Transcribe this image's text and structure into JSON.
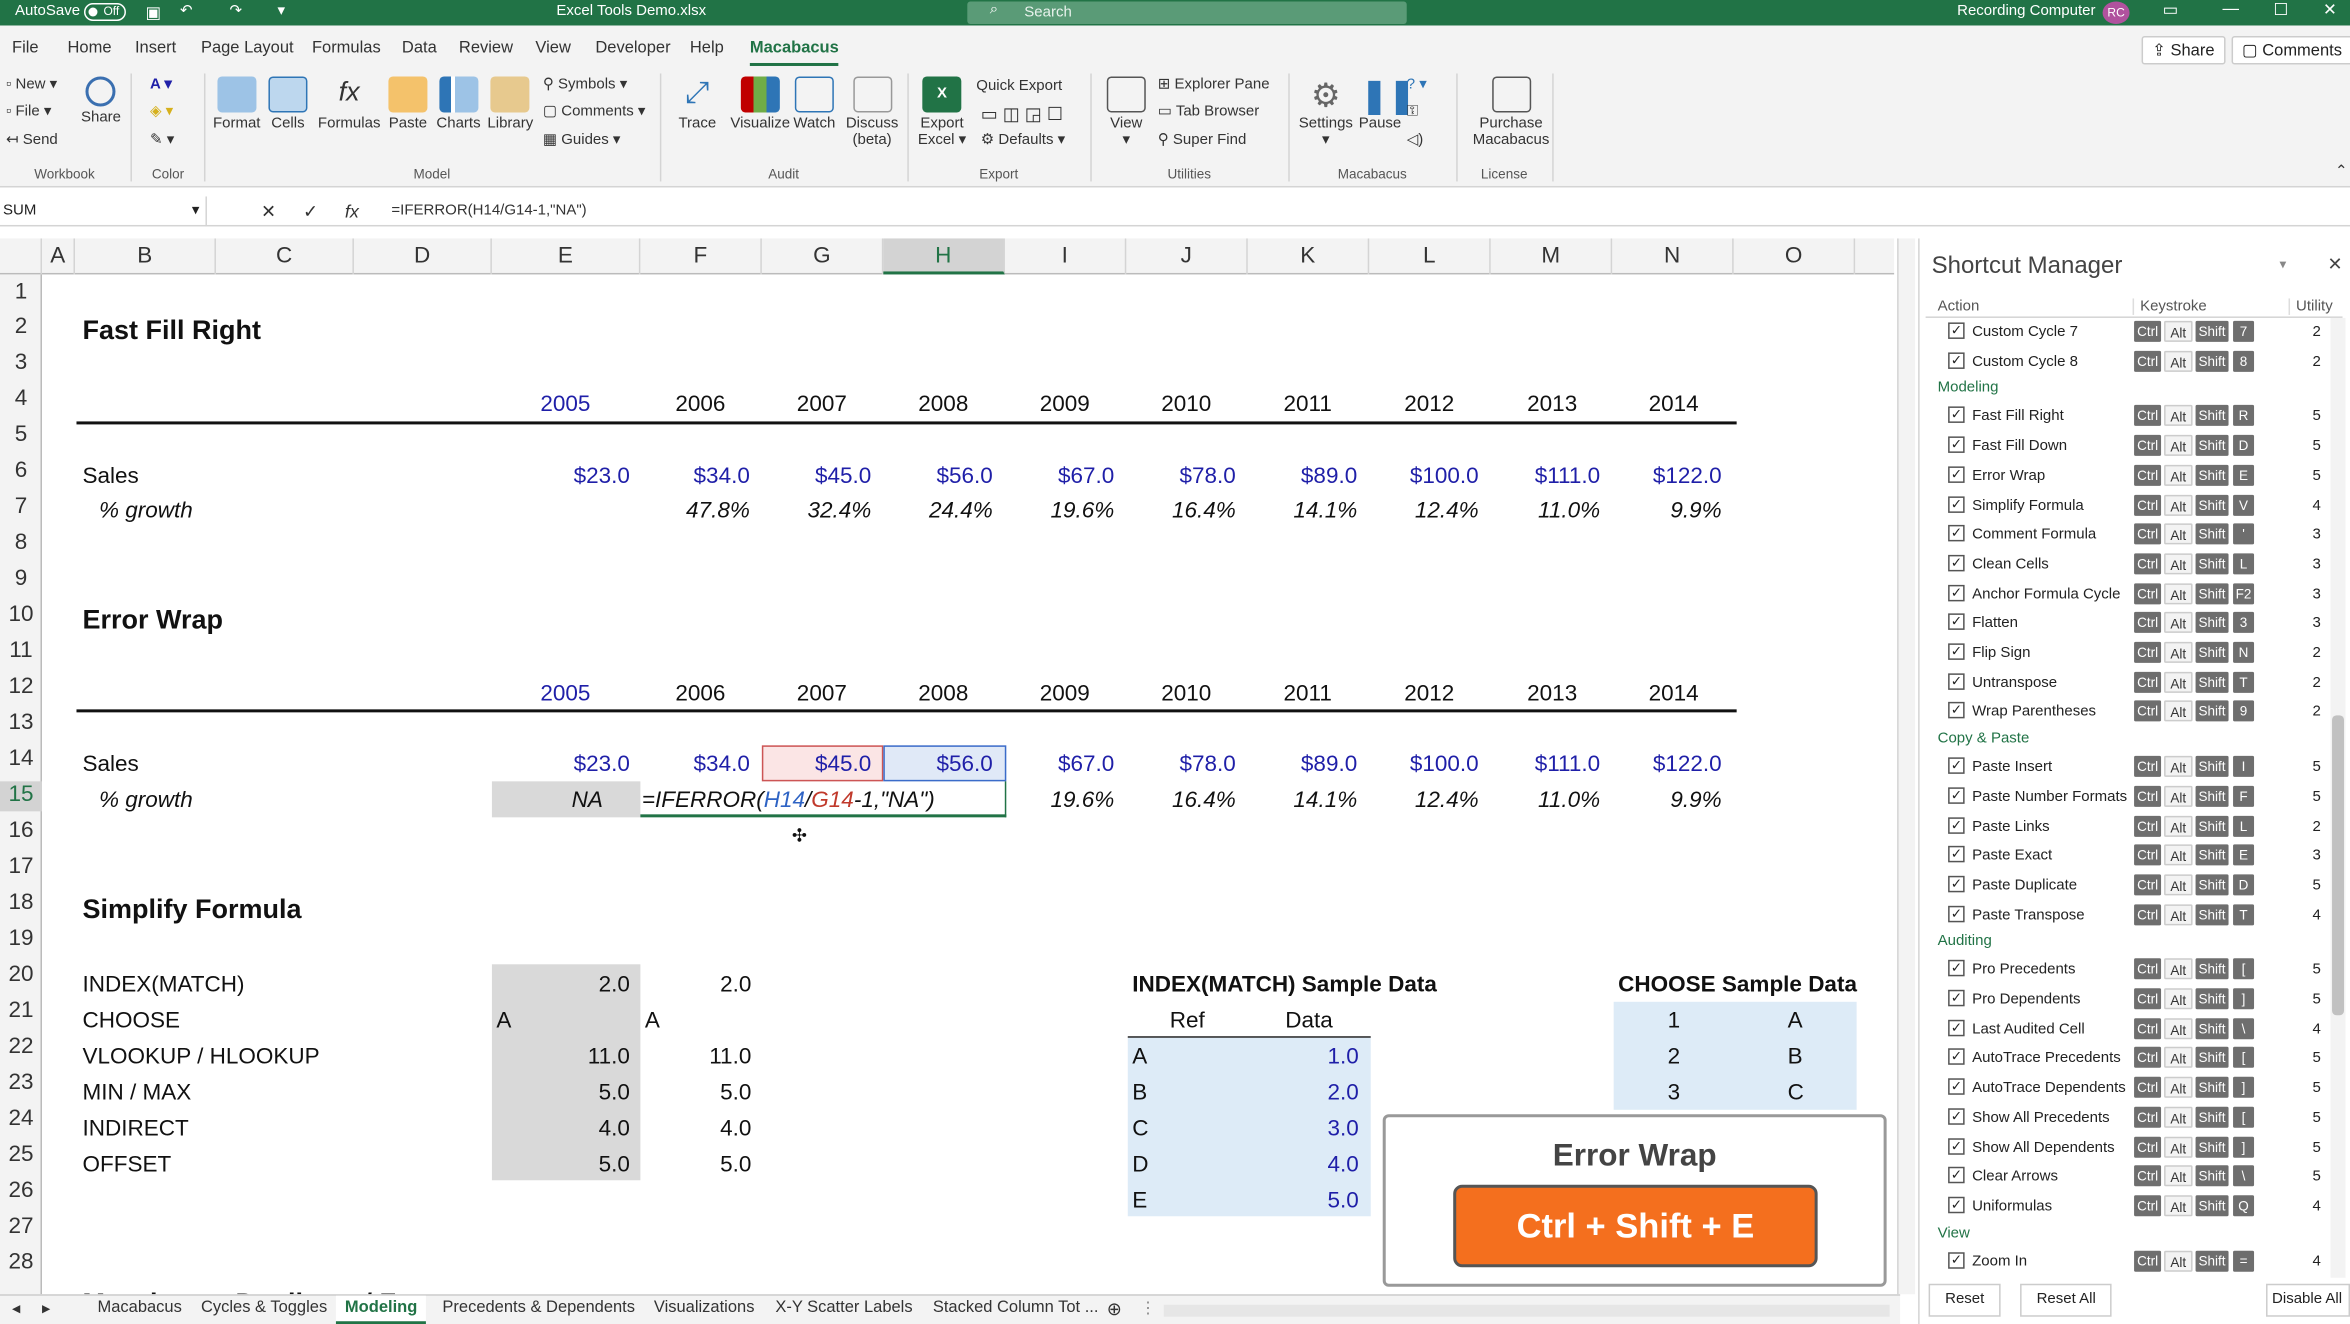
{
  "titlebar": {
    "autosave": "AutoSave",
    "toggle": "Off",
    "filename": "Excel Tools Demo.xlsx",
    "search": "Search",
    "user": "Recording Computer",
    "initials": "RC"
  },
  "menu": {
    "items": [
      "File",
      "Home",
      "Insert",
      "Page Layout",
      "Formulas",
      "Data",
      "Review",
      "View",
      "Developer",
      "Help",
      "Macabacus"
    ],
    "share": "Share",
    "comments": "Comments"
  },
  "ribbon": {
    "workbook": {
      "new": "New",
      "file": "File",
      "send": "Send",
      "share": "Share",
      "label": "Workbook"
    },
    "color": {
      "label": "Color"
    },
    "model": {
      "format": "Format",
      "cells": "Cells",
      "formulas": "Formulas",
      "paste": "Paste",
      "charts": "Charts",
      "library": "Library",
      "symbols": "Symbols",
      "comments": "Comments",
      "guides": "Guides",
      "label": "Model"
    },
    "audit": {
      "trace": "Trace",
      "visualize": "Visualize",
      "watch": "Watch",
      "discuss": "Discuss",
      "beta": "(beta)",
      "label": "Audit"
    },
    "export": {
      "quick": "Quick Export",
      "export": "Export",
      "excel": "Excel",
      "defaults": "Defaults",
      "label": "Export"
    },
    "utilities": {
      "view": "View",
      "explorer": "Explorer Pane",
      "tab": "Tab Browser",
      "superfind": "Super Find",
      "label": "Utilities"
    },
    "macabacus": {
      "settings": "Settings",
      "pause": "Pause",
      "label": "Macabacus"
    },
    "license": {
      "purchase": "Purchase",
      "macabacus": "Macabacus",
      "label": "License"
    }
  },
  "formula_bar": {
    "namebox": "SUM",
    "formula": "=IFERROR(H14/G14-1,\"NA\")",
    "x": "✕",
    "check": "✓",
    "fx": "fx"
  },
  "columns": [
    "A",
    "B",
    "C",
    "D",
    "E",
    "F",
    "G",
    "H",
    "I",
    "J",
    "K",
    "L",
    "M",
    "N",
    "O"
  ],
  "rows": [
    "1",
    "2",
    "3",
    "4",
    "5",
    "6",
    "7",
    "8",
    "9",
    "10",
    "11",
    "12",
    "13",
    "14",
    "15",
    "16",
    "17",
    "18",
    "19",
    "20",
    "21",
    "22",
    "23",
    "24",
    "25",
    "26",
    "27",
    "28"
  ],
  "sheet": {
    "s1_title": "Fast Fill Right",
    "years": [
      "2005",
      "2006",
      "2007",
      "2008",
      "2009",
      "2010",
      "2011",
      "2012",
      "2013",
      "2014"
    ],
    "sales_label": "Sales",
    "growth_label": "% growth",
    "sales": [
      "$23.0",
      "$34.0",
      "$45.0",
      "$56.0",
      "$67.0",
      "$78.0",
      "$89.0",
      "$100.0",
      "$111.0",
      "$122.0"
    ],
    "growth": [
      "47.8%",
      "32.4%",
      "24.4%",
      "19.6%",
      "16.4%",
      "14.1%",
      "12.4%",
      "11.0%",
      "9.9%"
    ],
    "s2_title": "Error Wrap",
    "s2_na": "NA",
    "s2_edit": {
      "p1": "=IFERROR(",
      "r1": "H14",
      "slash": "/",
      "r2": "G14",
      "p2": "-1,\"NA\")"
    },
    "s2_growth": [
      "19.6%",
      "16.4%",
      "14.1%",
      "12.4%",
      "11.0%",
      "9.9%"
    ],
    "s3_title": "Simplify Formula",
    "s3_labels": [
      "INDEX(MATCH)",
      "CHOOSE",
      "VLOOKUP / HLOOKUP",
      "MIN / MAX",
      "INDIRECT",
      "OFFSET"
    ],
    "s3_e": [
      "2.0",
      "A",
      "11.0",
      "5.0",
      "4.0",
      "5.0"
    ],
    "s3_f": [
      "2.0",
      "A",
      "11.0",
      "5.0",
      "4.0",
      "5.0"
    ],
    "idx_title": "INDEX(MATCH) Sample Data",
    "idx_hdr": [
      "Ref",
      "Data"
    ],
    "idx_refs": [
      "A",
      "B",
      "C",
      "D",
      "E"
    ],
    "idx_data": [
      "1.0",
      "2.0",
      "3.0",
      "4.0",
      "5.0"
    ],
    "ch_title": "CHOOSE Sample Data",
    "ch_nums": [
      "1",
      "2",
      "3"
    ],
    "ch_letters": [
      "A",
      "B",
      "C"
    ],
    "row28_text": "Macabacus Duplicate / F"
  },
  "tabs": [
    "Macabacus",
    "Cycles & Toggles",
    "Modeling",
    "Precedents & Dependents",
    "Visualizations",
    "X-Y Scatter Labels",
    "Stacked Column Tot ..."
  ],
  "shortcut_manager": {
    "title": "Shortcut Manager",
    "headers": [
      "Action",
      "Keystroke",
      "Utility"
    ],
    "rows": [
      {
        "t": "item",
        "label": "Custom Cycle 7",
        "key": "7",
        "util": "2"
      },
      {
        "t": "item",
        "label": "Custom Cycle 8",
        "key": "8",
        "util": "2"
      },
      {
        "t": "cat",
        "label": "Modeling"
      },
      {
        "t": "item",
        "label": "Fast Fill Right",
        "key": "R",
        "util": "5"
      },
      {
        "t": "item",
        "label": "Fast Fill Down",
        "key": "D",
        "util": "5"
      },
      {
        "t": "item",
        "label": "Error Wrap",
        "key": "E",
        "util": "5"
      },
      {
        "t": "item",
        "label": "Simplify Formula",
        "key": "V",
        "util": "4"
      },
      {
        "t": "item",
        "label": "Comment Formula",
        "key": "'",
        "util": "3"
      },
      {
        "t": "item",
        "label": "Clean Cells",
        "key": "L",
        "util": "3"
      },
      {
        "t": "item",
        "label": "Anchor Formula Cycle",
        "key": "F2",
        "util": "3"
      },
      {
        "t": "item",
        "label": "Flatten",
        "key": "3",
        "util": "3"
      },
      {
        "t": "item",
        "label": "Flip Sign",
        "key": "N",
        "util": "2"
      },
      {
        "t": "item",
        "label": "Untranspose",
        "key": "T",
        "util": "2"
      },
      {
        "t": "item",
        "label": "Wrap Parentheses",
        "key": "9",
        "util": "2"
      },
      {
        "t": "cat",
        "label": "Copy & Paste"
      },
      {
        "t": "item",
        "label": "Paste Insert",
        "key": "I",
        "util": "5"
      },
      {
        "t": "item",
        "label": "Paste Number Formats",
        "key": "F",
        "util": "5"
      },
      {
        "t": "item",
        "label": "Paste Links",
        "key": "L",
        "util": "2"
      },
      {
        "t": "item",
        "label": "Paste Exact",
        "key": "E",
        "util": "3"
      },
      {
        "t": "item",
        "label": "Paste Duplicate",
        "key": "D",
        "util": "5"
      },
      {
        "t": "item",
        "label": "Paste Transpose",
        "key": "T",
        "util": "4"
      },
      {
        "t": "cat",
        "label": "Auditing"
      },
      {
        "t": "item",
        "label": "Pro Precedents",
        "key": "[",
        "util": "5"
      },
      {
        "t": "item",
        "label": "Pro Dependents",
        "key": "]",
        "util": "5"
      },
      {
        "t": "item",
        "label": "Last Audited Cell",
        "key": "\\",
        "util": "4"
      },
      {
        "t": "item",
        "label": "AutoTrace Precedents",
        "key": "[",
        "util": "5"
      },
      {
        "t": "item",
        "label": "AutoTrace Dependents",
        "key": "]",
        "util": "5"
      },
      {
        "t": "item",
        "label": "Show All Precedents",
        "key": "[",
        "util": "5"
      },
      {
        "t": "item",
        "label": "Show All Dependents",
        "key": "]",
        "util": "5"
      },
      {
        "t": "item",
        "label": "Clear Arrows",
        "key": "\\",
        "util": "5"
      },
      {
        "t": "item",
        "label": "Uniformulas",
        "key": "Q",
        "util": "4"
      },
      {
        "t": "cat",
        "label": "View"
      },
      {
        "t": "item",
        "label": "Zoom In",
        "key": "=",
        "util": "4"
      }
    ],
    "mods": [
      "Ctrl",
      "Alt",
      "Shift"
    ],
    "reset": "Reset",
    "reset_all": "Reset All",
    "disable_all": "Disable All"
  },
  "popup": {
    "title": "Error Wrap",
    "keys": "Ctrl + Shift + E"
  },
  "colors": {
    "excel_green": "#217346",
    "blue_text": "#1f1fa8",
    "popup_orange": "#f46f1e",
    "light_blue": "#ddebf7"
  }
}
